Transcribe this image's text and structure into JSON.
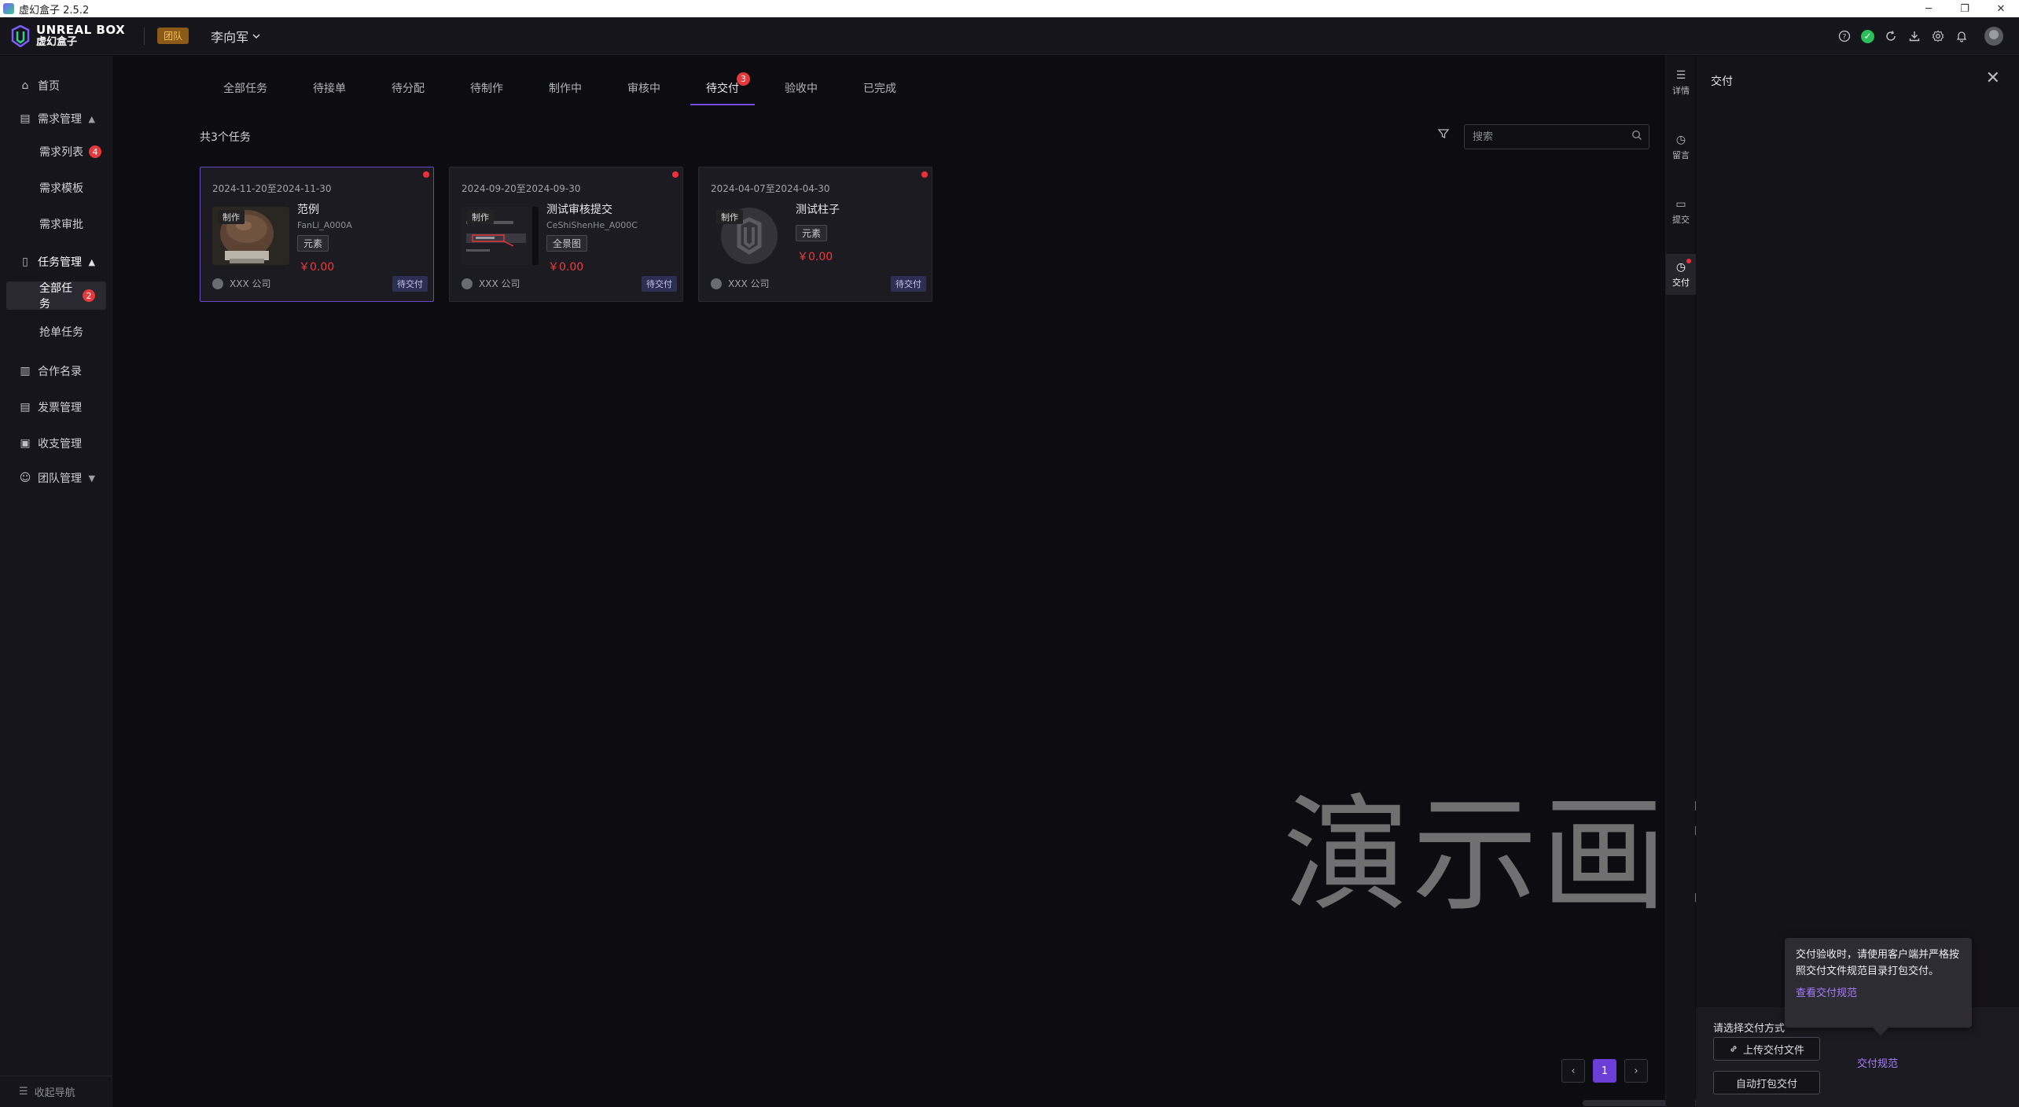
{
  "window": {
    "title": "虚幻盒子 2.5.2",
    "controls": [
      "─",
      "❐",
      "✕"
    ]
  },
  "header": {
    "logo_en": "UNREAL BOX",
    "logo_cn": "虚幻盒子",
    "team_tag": "团队",
    "user_name": "李向军",
    "icons": [
      "help-icon",
      "status-ok-icon",
      "refresh-icon",
      "download-icon",
      "settings-icon",
      "bell-icon",
      "avatar"
    ]
  },
  "sidebar": {
    "home": "首页",
    "demand_mgmt": "需求管理",
    "demand_list": "需求列表",
    "demand_list_badge": "4",
    "demand_template": "需求模板",
    "demand_approval": "需求审批",
    "task_mgmt": "任务管理",
    "all_tasks": "全部任务",
    "all_tasks_badge": "2",
    "grab_tasks": "抢单任务",
    "partners": "合作名录",
    "invoice": "发票管理",
    "finance": "收支管理",
    "team": "团队管理",
    "collapse": "收起导航"
  },
  "tabs": [
    {
      "label": "全部任务"
    },
    {
      "label": "待接单"
    },
    {
      "label": "待分配"
    },
    {
      "label": "待制作"
    },
    {
      "label": "制作中"
    },
    {
      "label": "审核中"
    },
    {
      "label": "待交付",
      "badge": "3",
      "active": true
    },
    {
      "label": "验收中"
    },
    {
      "label": "已完成"
    }
  ],
  "main": {
    "total": "共3个任务",
    "search_placeholder": "搜索"
  },
  "cards": [
    {
      "date": "2024-11-20至2024-11-30",
      "kind": "制作",
      "name": "范例",
      "code": "FanLi_A000A",
      "tag": "元素",
      "price": "￥0.00",
      "owner": "XXX 公司",
      "status": "待交付"
    },
    {
      "date": "2024-09-20至2024-09-30",
      "kind": "制作",
      "name": "测试审核提交",
      "code": "CeShiShenHe_A000C",
      "tag": "全景图",
      "price": "￥0.00",
      "owner": "XXX 公司",
      "status": "待交付"
    },
    {
      "date": "2024-04-07至2024-04-30",
      "kind": "制作",
      "name": "测试柱子",
      "code": "",
      "tag": "元素",
      "price": "￥0.00",
      "owner": "XXX 公司",
      "status": "待交付"
    }
  ],
  "watermark": "演示画面",
  "pagination": {
    "prev": "‹",
    "current": "1",
    "next": "›"
  },
  "rail": {
    "detail": "详情",
    "message": "留言",
    "submit": "提交",
    "deliver": "交付"
  },
  "drawer": {
    "title": "交付",
    "close": "✕",
    "choose_label": "请选择交付方式",
    "upload_button": "上传交付文件",
    "auto_button": "自动打包交付",
    "spec_link": "交付规范",
    "popover_text": "交付验收时，请使用客户端并严格按照交付文件规范目录打包交付。",
    "popover_link": "查看交付规范"
  },
  "colors": {
    "accent": "#6b3fd6",
    "badge": "#e5393b",
    "price": "#ef3b3b"
  }
}
